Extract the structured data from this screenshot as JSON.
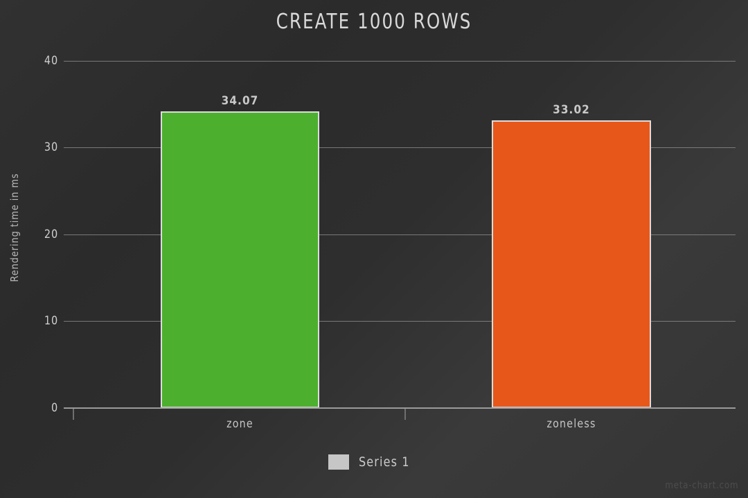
{
  "chart_data": {
    "type": "bar",
    "title": "CREATE 1000 ROWS",
    "xlabel": "",
    "ylabel": "Rendering time in ms",
    "categories": [
      "zone",
      "zoneless"
    ],
    "values": [
      34.07,
      33.02
    ],
    "value_labels": [
      "34.07",
      "33.02"
    ],
    "bar_colors": [
      "#4cb02e",
      "#e8571a"
    ],
    "bar_border_color": "#dcdcdc",
    "series": [
      {
        "name": "Series 1",
        "values": [
          34.07,
          33.02
        ]
      }
    ],
    "ylim": [
      0,
      40
    ],
    "yticks": [
      40,
      30,
      20,
      10,
      0
    ],
    "ytick_labels": [
      "40",
      "30",
      "20",
      "10",
      "0"
    ],
    "grid": true,
    "grid_color": "#8e8e8e",
    "legend": {
      "position": "bottom",
      "entries": [
        {
          "label": "Series 1",
          "color": "#c6c6c6"
        }
      ]
    },
    "background_color": "#2e2e2e",
    "text_color": "#cfcfcf"
  },
  "watermark": {
    "text": "meta-chart.com"
  }
}
